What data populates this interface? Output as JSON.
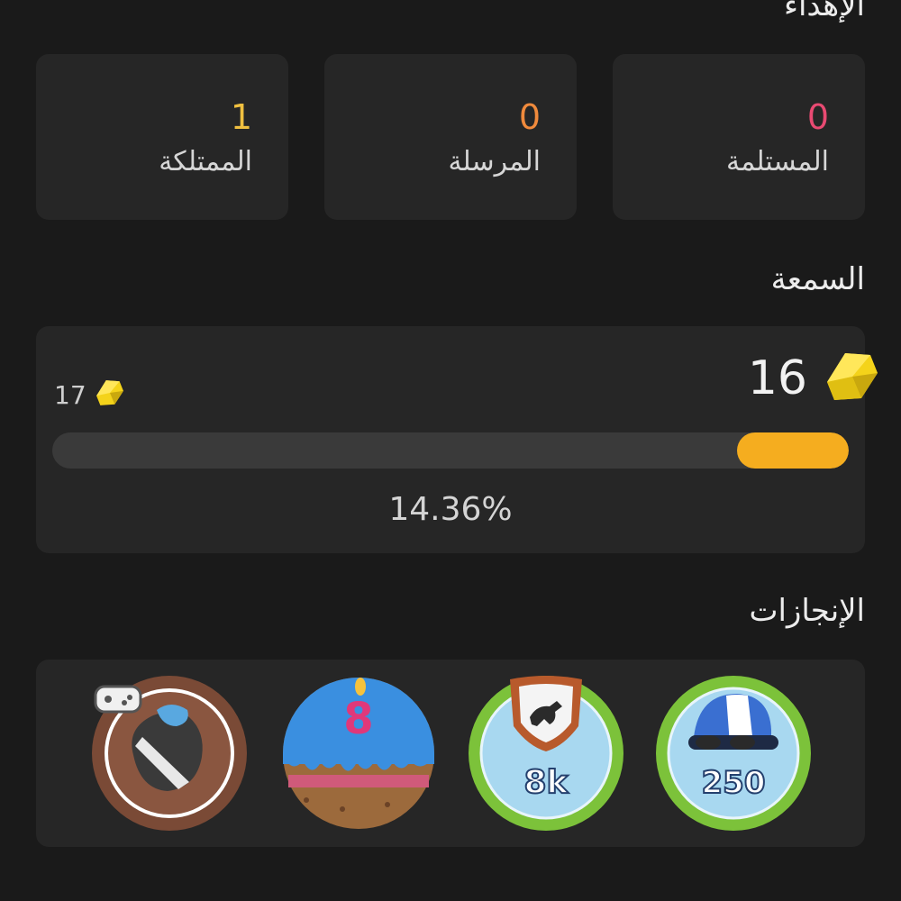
{
  "gifts": {
    "title": "الإهداء",
    "cards": [
      {
        "value": "0",
        "label": "المستلمة",
        "color": "#e84a72"
      },
      {
        "value": "0",
        "label": "المرسلة",
        "color": "#f08a3c"
      },
      {
        "value": "1",
        "label": "الممتلكة",
        "color": "#f0c040"
      }
    ]
  },
  "reputation": {
    "title": "السمعة",
    "current": "16",
    "next": "17",
    "percent": "14.36%",
    "progress_fraction": 0.14,
    "gem_color": "#f4d31a",
    "bar_color": "#f5ad1f"
  },
  "achievements": {
    "title": "الإنجازات",
    "badges": [
      {
        "icon": "jockey-helmet-badge-icon",
        "label": "250"
      },
      {
        "icon": "horse-shield-badge-icon",
        "label": "8k"
      },
      {
        "icon": "birthday-cake-badge-icon",
        "label": "8"
      },
      {
        "icon": "gamer-jockey-badge-icon",
        "label": ""
      }
    ]
  }
}
